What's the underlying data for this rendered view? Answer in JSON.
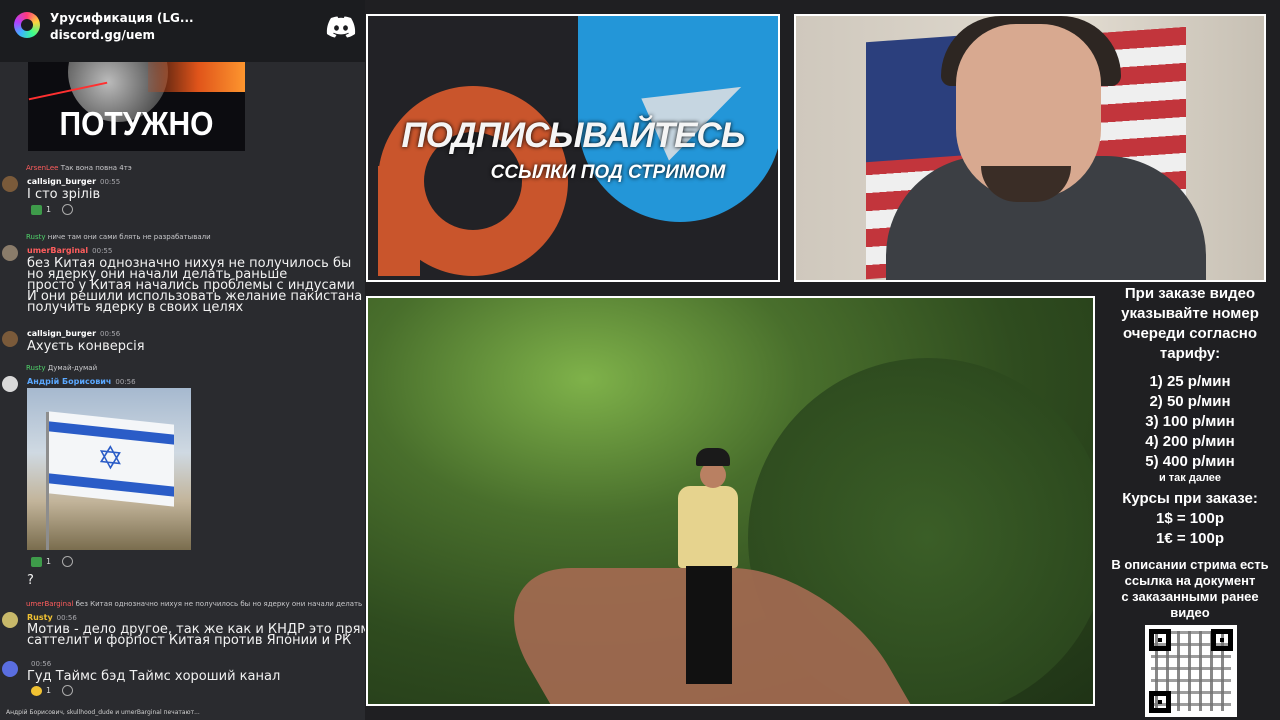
{
  "discord": {
    "server_name": "Урусификация (LG...",
    "invite_link": "discord.gg/uem"
  },
  "chat": {
    "image_caption_text": "ПОТУЖНО",
    "messages": [
      {
        "reply_user": "ArsenLee",
        "reply_text": "Так вона повна 4тэ",
        "author": "callsign_burger",
        "time": "00:55",
        "text": "І сто зрілів",
        "reaction_count": "1"
      },
      {
        "reply_user": "Rusty",
        "reply_text": "ниче там они сами блять не разрабатывали",
        "author": "umerBarginal",
        "time": "00:55",
        "text": "без Китая однозначно нихуя не получилось бы\nно ядерку они начали делать раньше\nпросто у Китая начались проблемы с индусами\nИ они решили использовать желание пакистана\nполучить ядерку в своих целях"
      },
      {
        "author": "callsign_burger",
        "time": "00:56",
        "text": "Ахуєть конверсія"
      },
      {
        "reply_user": "Rusty",
        "reply_text": "Думай-думай",
        "author": "Андрій Борисович",
        "time": "00:56",
        "reaction_count": "1",
        "text_after": "?"
      },
      {
        "reply_user": "umerBarginal",
        "reply_text": "без Китая однозначно нихуя не получилось бы  но ядерку они начали делать ран",
        "author": "Rusty",
        "time": "00:56",
        "text": "Мотив - дело другое, так же как и КНДР это прямой\nсаттелит и форпост Китая против Японии и РК"
      },
      {
        "author": "",
        "time": "00:56",
        "text": "Гуд Таймс бэд Таймс хороший канал",
        "reaction_count": "1"
      }
    ],
    "typing_indicator": "Андрій Борисович, skullhood_dude и umerBarginal печатают..."
  },
  "promo": {
    "title": "ПОДПИСЫВАЙТЕСЬ",
    "subtitle": "ССЫЛКИ ПОД СТРИМОМ"
  },
  "order_info": {
    "intro_lines": [
      "При заказе видео",
      "указывайте номер",
      "очереди согласно",
      "тарифу:"
    ],
    "tariffs": [
      "1) 25 р/мин",
      "2) 50 р/мин",
      "3) 100 р/мин",
      "4) 200 р/мин",
      "5) 400 р/мин"
    ],
    "tariffs_more": "и так далее",
    "rates_title": "Курсы при заказе:",
    "rates": [
      "1$ = 100р",
      "1€ = 100р"
    ],
    "doc_lines": [
      "В описании стрима есть",
      "ссылка на документ",
      "с заказанными ранее",
      "видео"
    ]
  },
  "colors": {
    "discord_bg": "#2a2b2f",
    "telegram_blue": "#2396d8",
    "patreon_orange": "#c9552c",
    "red_user": "#ff5d5d",
    "blue_user": "#5aa8ff",
    "green_user": "#4fd36a"
  }
}
